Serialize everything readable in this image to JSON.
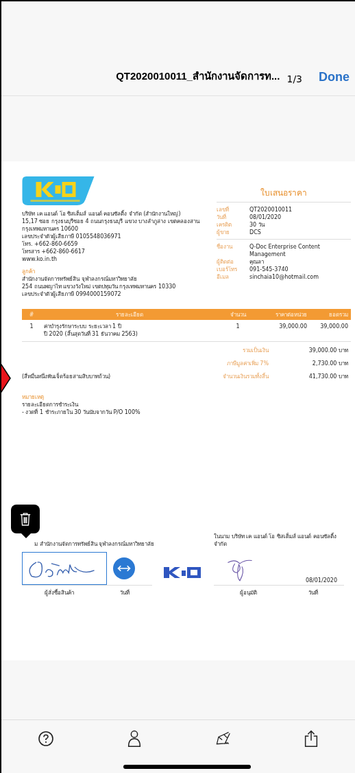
{
  "header": {
    "title": "QT2020010011_สำนักงานจัดการท...",
    "page_count": "1/3",
    "done": "Done"
  },
  "company": {
    "lines": [
      "บริษัท เค แอนด์ โอ ซิสเต็มส์ แอนด์ คอนซัลติ้ง จำกัด (สำนักงานใหญ่)",
      "15,17 ซอย กรุงธนบุรีซอย 4 ถนนกรุงธนบุรี แขวง บางลำภูล่าง เขตคลองสาน",
      "กรุงเทพมหานคร 10600",
      "เลขประจำตัวผู้เสียภาษี 0105548036971",
      "โทร. +662-860-6659",
      "โทรสาร +662-860-6617",
      "www.ko.in.th"
    ]
  },
  "customer": {
    "label": "ลูกค้า",
    "lines": [
      "สำนักงานจัดการทรัพย์สิน จุฬาลงกรณ์มหาวิทยาลัย",
      "254 ถนนพญาไท แขวงวังใหม่ เขตปทุมวัน กรุงเทพมหานคร 10330",
      "เลขประจำตัวผู้เสียภาษี 0994000159072"
    ]
  },
  "doc_title": "ใบเสนอราคา",
  "info_groups": [
    [
      {
        "label": "เลขที่",
        "value": "QT2020010011"
      },
      {
        "label": "วันที่",
        "value": "08/01/2020"
      },
      {
        "label": "เครดิต",
        "value": "30 วัน"
      },
      {
        "label": "ผู้ขาย",
        "value": "DCS"
      }
    ],
    [
      {
        "label": "ชื่องาน",
        "value": "Q-Doc Enterprise Content Management"
      },
      {
        "label": "ผู้ติดต่อ",
        "value": "คุณลา"
      },
      {
        "label": "เบอร์โทร",
        "value": "091-545-3740"
      },
      {
        "label": "อีเมล",
        "value": "sinchaia10@hotmail.com"
      }
    ]
  ],
  "table": {
    "columns": [
      "#",
      "รายละเอียด",
      "จำนวน",
      "ราคาต่อหน่วย",
      "ยอดรวม"
    ],
    "rows": [
      {
        "no": "1",
        "detail": [
          "ค่าบำรุงรักษาระบบ ระยะเวลา 1 ปี",
          "ปี 2020 (สิ้นสุดวันที่ 31 ธันวาคม 2563)"
        ],
        "qty": "1",
        "unit_price": "39,000.00",
        "total": "39,000.00"
      }
    ]
  },
  "totals": [
    {
      "label": "รวมเป็นเงิน",
      "value": "39,000.00 บาท"
    },
    {
      "label": "ภาษีมูลค่าเพิ่ม 7%",
      "value": "2,730.00 บาท"
    },
    {
      "label": "จำนวนเงินรวมทั้งสิ้น",
      "value": "41,730.00 บาท"
    }
  ],
  "amount_words": "(สี่หมื่นหนึ่งพันเจ็ดร้อยสามสิบบาทถ้วน)",
  "notes": {
    "label": "หมายเหตุ",
    "lines": [
      "รายละเอียดการชำระเงิน",
      "- งวดที่ 1 ชำระภายใน 30 วันนับจากวัน P/O 100%"
    ]
  },
  "signatures": {
    "left": {
      "caption": "ม สำนักงานจัดการทรัพย์สิน จุฬาลงกรณ์มหาวิทยาลัย",
      "selected": true,
      "signer_label": "ผู้สั่งซื้อสินค้า",
      "date_label": "วันที่"
    },
    "right": {
      "caption": "ในนาม บริษัท เค แอนด์ โอ ซิสเต็มส์ แอนด์ คอนซัลติ้ง จำกัด",
      "date": "08/01/2020",
      "signer_label": "ผู้อนุมัติ",
      "date_label": "วันที่"
    }
  }
}
